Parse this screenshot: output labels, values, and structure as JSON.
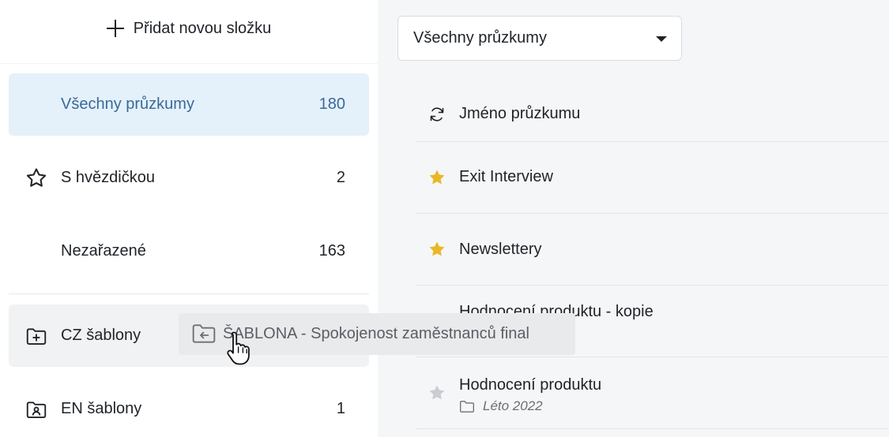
{
  "sidebar": {
    "add_folder_label": "Přidat novou složku",
    "items": [
      {
        "label": "Všechny průzkumy",
        "count": "180",
        "icon": "none"
      },
      {
        "label": "S hvězdičkou",
        "count": "2",
        "icon": "star-outline-icon"
      },
      {
        "label": "Nezařazené",
        "count": "163",
        "icon": "none"
      },
      {
        "label": "CZ šablony",
        "count": "",
        "icon": "folder-plus-icon"
      },
      {
        "label": "EN šablony",
        "count": "1",
        "icon": "folder-user-icon"
      }
    ]
  },
  "main": {
    "filter_value": "Všechny průzkumy",
    "list_header": "Jméno průzkumu",
    "rows": [
      {
        "title": "Exit Interview",
        "starred": true,
        "folder": ""
      },
      {
        "title": "Newslettery",
        "starred": true,
        "folder": ""
      },
      {
        "title": "Hodnocení produktu - kopie",
        "starred": false,
        "folder": ""
      },
      {
        "title": "Hodnocení produktu",
        "starred": false,
        "folder": "Léto 2022"
      }
    ]
  },
  "drag": {
    "label": "ŠABLONA - Spokojenost zaměstnanců final"
  },
  "colors": {
    "active_bg": "#e4f1fb",
    "active_text": "#3a6a96",
    "star_gold": "#e8b827",
    "star_grey": "#c9ccd1"
  }
}
